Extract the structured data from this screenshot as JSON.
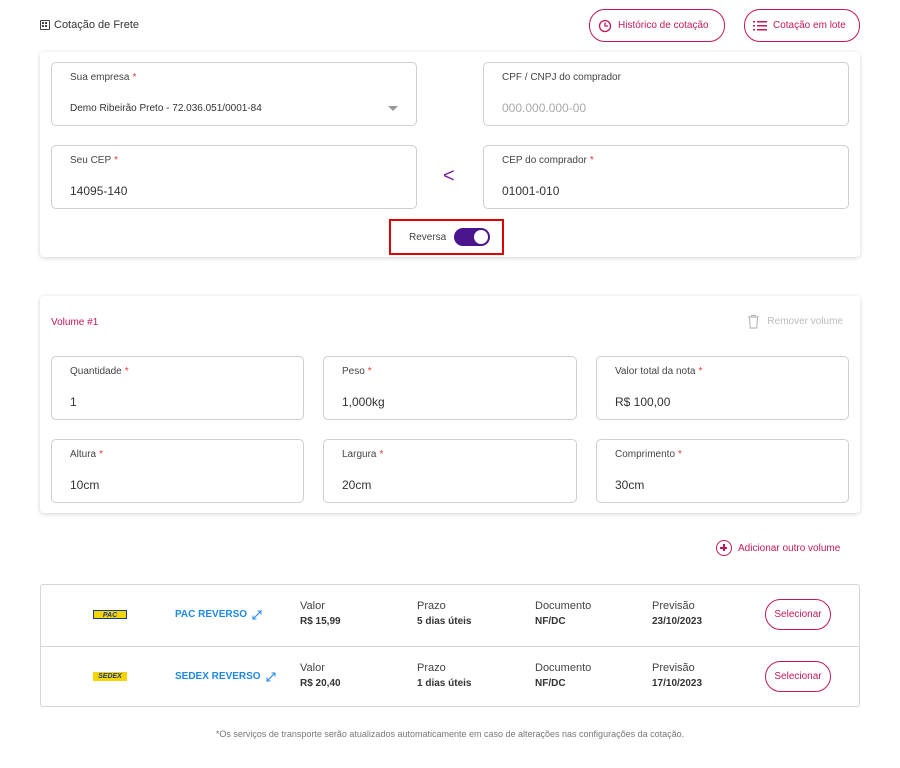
{
  "page": {
    "title": "Cotação de Frete"
  },
  "header_buttons": {
    "historico": "Histórico de cotação",
    "lote": "Cotação em lote"
  },
  "form": {
    "empresa": {
      "label": "Sua empresa",
      "value": "Demo Ribeirão Preto - 72.036.051/0001-84",
      "required": "*"
    },
    "cpf": {
      "label": "CPF / CNPJ do comprador",
      "placeholder": "000.000.000-00"
    },
    "cep_origem": {
      "label": "Seu CEP",
      "value": "14095-140",
      "required": "*"
    },
    "cep_destino": {
      "label": "CEP do comprador",
      "value": "01001-010",
      "required": "*"
    },
    "swap_glyph": "<",
    "reversa": {
      "label": "Reversa",
      "enabled": true
    }
  },
  "volume": {
    "title": "Volume #1",
    "remove_label": "Remover volume",
    "quantidade": {
      "label": "Quantidade",
      "value": "1"
    },
    "peso": {
      "label": "Peso",
      "value": "1,000kg"
    },
    "valor_nota": {
      "label": "Valor total da nota",
      "value": "R$ 100,00"
    },
    "altura": {
      "label": "Altura",
      "value": "10cm"
    },
    "largura": {
      "label": "Largura",
      "value": "20cm"
    },
    "comprimento": {
      "label": "Comprimento",
      "value": "30cm"
    },
    "required": "*"
  },
  "add_volume": "Adicionar outro volume",
  "results": {
    "headers": {
      "valor": "Valor",
      "prazo": "Prazo",
      "documento": "Documento",
      "previsao": "Previsão"
    },
    "select_label": "Selecionar",
    "rows": [
      {
        "logo": "PAC",
        "service": "PAC REVERSO",
        "valor": "R$ 15,99",
        "prazo": "5 dias úteis",
        "documento": "NF/DC",
        "previsao": "23/10/2023"
      },
      {
        "logo": "SEDEX",
        "service": "SEDEX REVERSO",
        "valor": "R$ 20,40",
        "prazo": "1 dias úteis",
        "documento": "NF/DC",
        "previsao": "17/10/2023"
      }
    ]
  },
  "footnote": "*Os serviços de transporte serão atualizados automaticamente em caso de alterações nas configurações da cotação.",
  "colors": {
    "accent": "#c2185b",
    "toggle": "#4a148c",
    "link": "#1e88e5",
    "highlight": "#e00000"
  }
}
